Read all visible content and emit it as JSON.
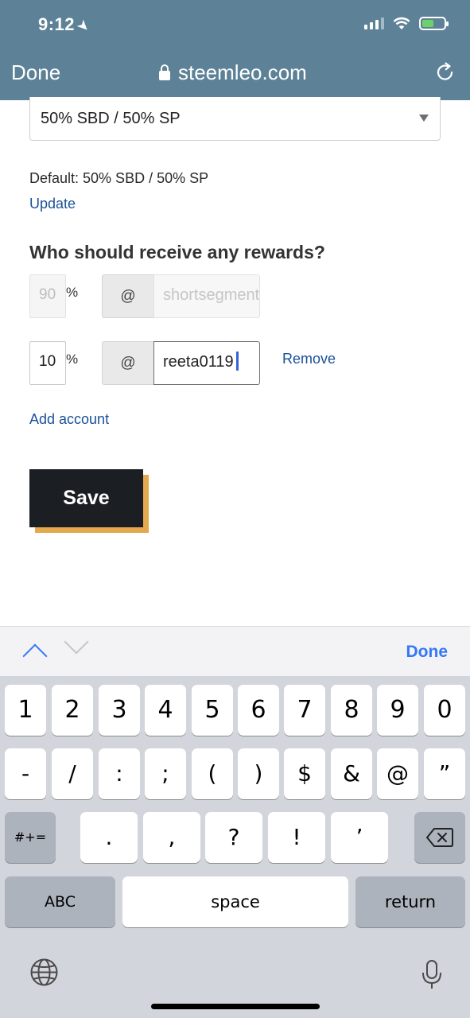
{
  "status_bar": {
    "time": "9:12"
  },
  "browser": {
    "done_label": "Done",
    "url": "steemleo.com"
  },
  "payout": {
    "selected": "50% SBD / 50% SP",
    "default_text": "Default: 50% SBD / 50% SP",
    "update_label": "Update"
  },
  "beneficiaries": {
    "heading": "Who should receive any rewards?",
    "percent_sign": "%",
    "at_sign": "@",
    "rows": [
      {
        "percent": "90",
        "account": "shortsegments"
      },
      {
        "percent": "10",
        "account": "reeta0119"
      }
    ],
    "remove_label": "Remove",
    "add_account_label": "Add account"
  },
  "save_label": "Save",
  "accessory": {
    "done_label": "Done"
  },
  "keyboard": {
    "row1": [
      "1",
      "2",
      "3",
      "4",
      "5",
      "6",
      "7",
      "8",
      "9",
      "0"
    ],
    "row2": [
      "-",
      "/",
      ":",
      ";",
      "(",
      ")",
      "$",
      "&",
      "@",
      "”"
    ],
    "row3_left": "#+=",
    "row3": [
      ".",
      ",",
      "?",
      "!",
      "’"
    ],
    "abc": "ABC",
    "space": "space",
    "return": "return"
  }
}
